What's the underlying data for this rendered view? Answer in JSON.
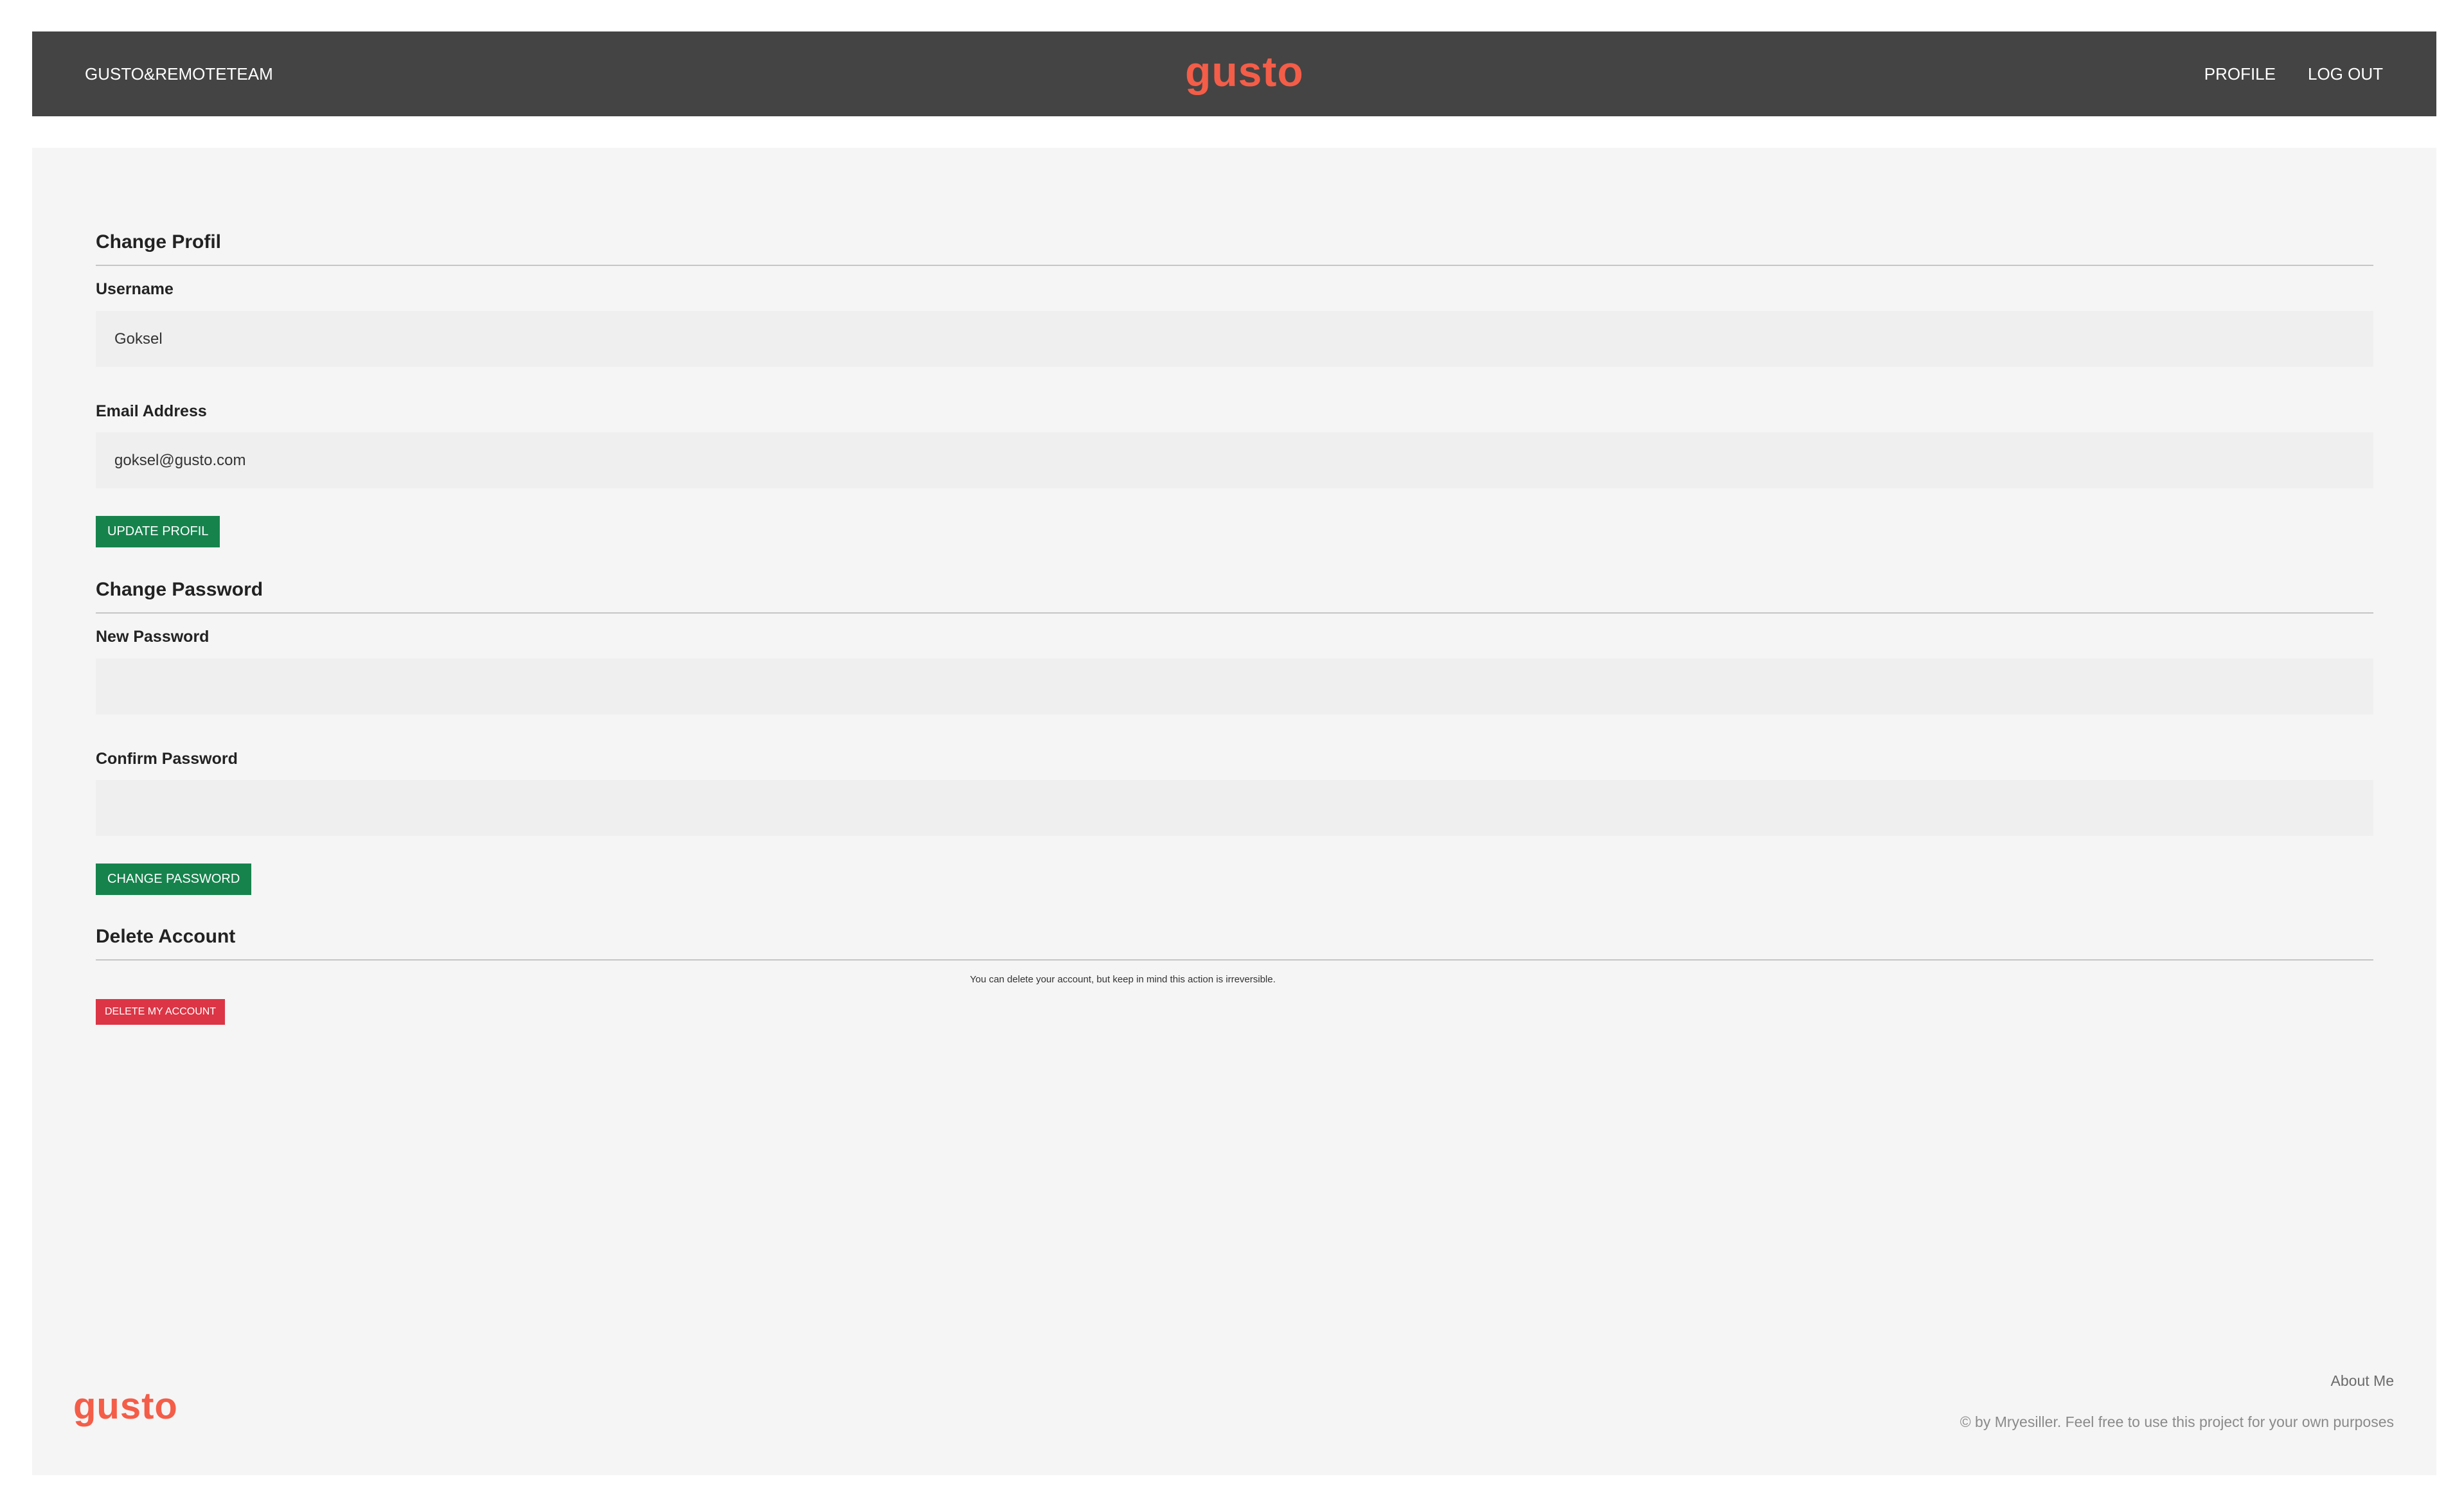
{
  "nav": {
    "brand": "GUSTO&REMOTETEAM",
    "logo": "gusto",
    "links": [
      "PROFILE",
      "LOG OUT"
    ]
  },
  "profile_section": {
    "title": "Change Profil",
    "username_label": "Username",
    "username_value": "Goksel",
    "email_label": "Email Address",
    "email_value": "goksel@gusto.com",
    "button": "UPDATE PROFIL"
  },
  "password_section": {
    "title": "Change Password",
    "new_label": "New Password",
    "new_value": "",
    "confirm_label": "Confirm Password",
    "confirm_value": "",
    "button": "CHANGE PASSWORD"
  },
  "delete_section": {
    "title": "Delete Account",
    "note": "You can delete your account, but keep in mind this action is irreversible.",
    "button": "DELETE MY ACCOUNT"
  },
  "footer": {
    "logo": "gusto",
    "about": "About Me",
    "copyright": "© by Mryesiller. Feel free to use this project for your own purposes"
  },
  "colors": {
    "navbar": "#444444",
    "brand_logo": "#f45d48",
    "primary_button": "#16834d",
    "danger_button": "#dc3545",
    "page_background": "#f5f5f5"
  }
}
